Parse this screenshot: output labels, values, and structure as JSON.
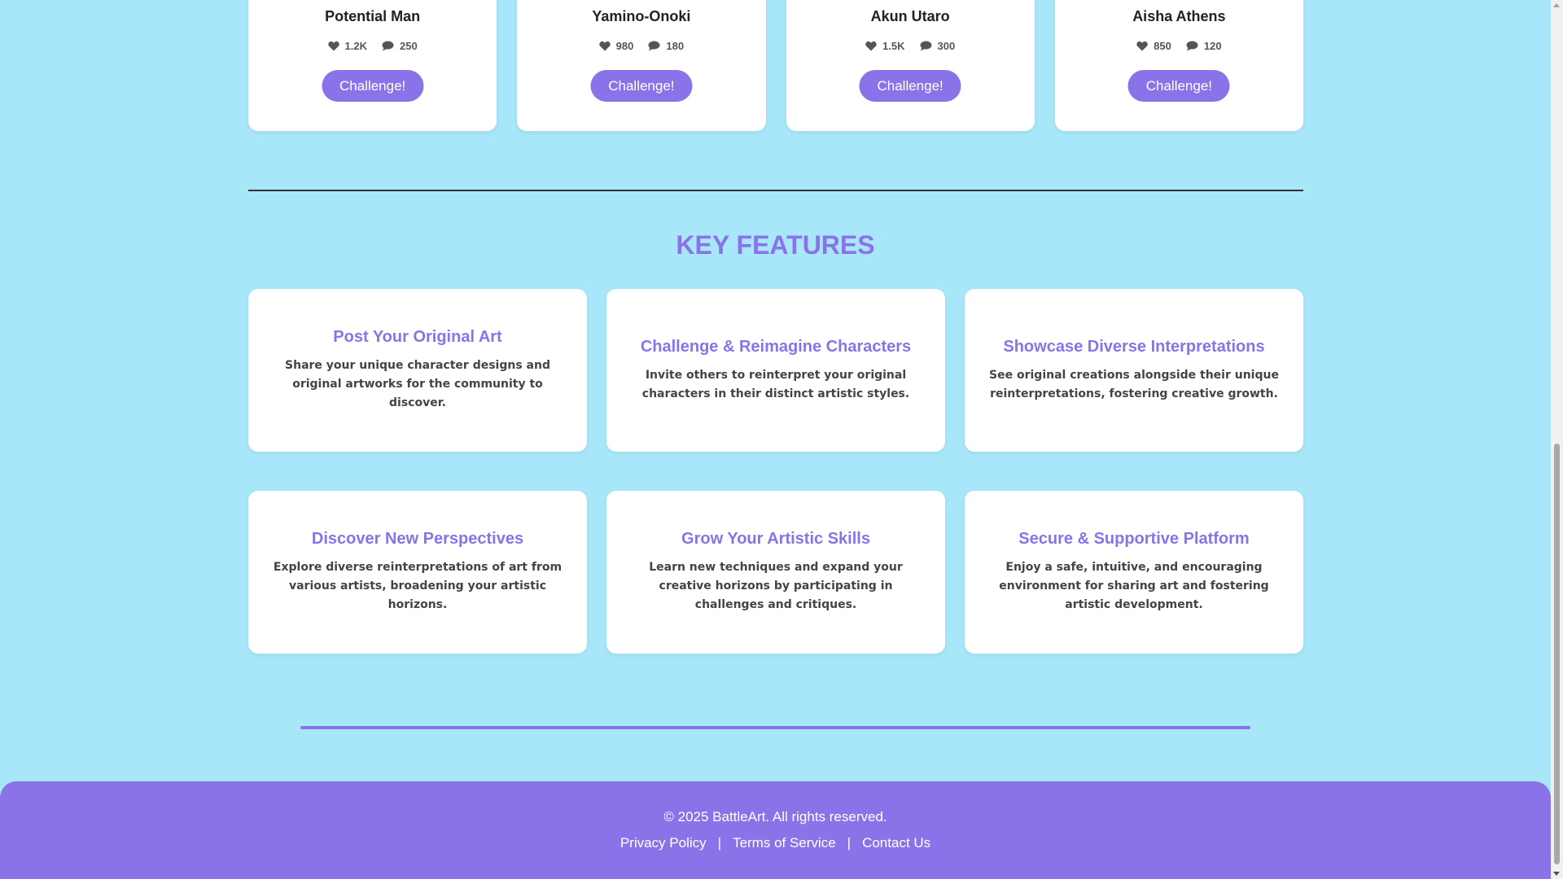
{
  "artists": [
    {
      "name": "Potential Man",
      "likes": "1.2K",
      "comments": "250",
      "button": "Challenge!"
    },
    {
      "name": "Yamino-Onoki",
      "likes": "980",
      "comments": "180",
      "button": "Challenge!"
    },
    {
      "name": "Akun Utaro",
      "likes": "1.5K",
      "comments": "300",
      "button": "Challenge!"
    },
    {
      "name": "Aisha Athens",
      "likes": "850",
      "comments": "120",
      "button": "Challenge!"
    }
  ],
  "features": {
    "title": "KEY FEATURES",
    "items": [
      {
        "title": "Post Your Original Art",
        "description": "Share your unique character designs and original artworks for the community to discover."
      },
      {
        "title": "Challenge & Reimagine Characters",
        "description": "Invite others to reinterpret your original characters in their distinct artistic styles."
      },
      {
        "title": "Showcase Diverse Interpretations",
        "description": "See original creations alongside their unique reinterpretations, fostering creative growth."
      },
      {
        "title": "Discover New Perspectives",
        "description": "Explore diverse reinterpretations of art from various artists, broadening your artistic horizons."
      },
      {
        "title": "Grow Your Artistic Skills",
        "description": "Learn new techniques and expand your creative horizons by participating in challenges and critiques."
      },
      {
        "title": "Secure & Supportive Platform",
        "description": "Enjoy a safe, intuitive, and encouraging environment for sharing art and fostering artistic development."
      }
    ]
  },
  "footer": {
    "copyright": "© 2025 BattleArt. All rights reserved.",
    "links": [
      "Privacy Policy",
      "Terms of Service",
      "Contact Us"
    ],
    "separator": "|"
  },
  "colors": {
    "background": "#a8e6fa",
    "accent": "#8a73e8",
    "card": "#ffffff"
  },
  "icons": {
    "likes": "heart-icon",
    "comments": "comment-icon"
  }
}
